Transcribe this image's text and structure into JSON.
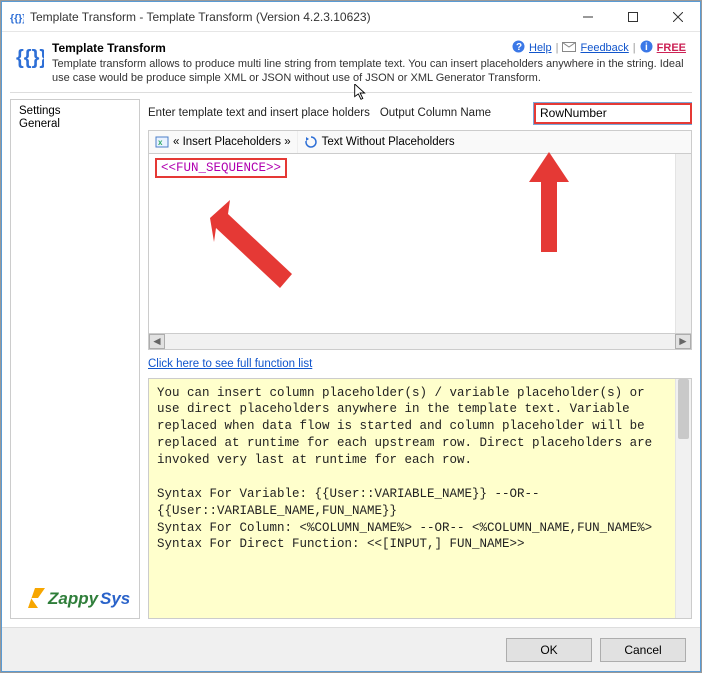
{
  "window": {
    "title": "Template Transform - Template Transform (Version 4.2.3.10623)"
  },
  "header": {
    "title": "Template Transform",
    "desc": "Template transform allows to produce multi line string from template text. You can insert placeholders anywhere in the string. Ideal use case would be produce simple XML or JSON without use of JSON or XML Generator Transform.",
    "help": "Help",
    "feedback": "Feedback",
    "free": "FREE"
  },
  "sidebar": {
    "items": [
      "Settings",
      "General"
    ]
  },
  "main": {
    "template_label": "Enter template text and insert place holders",
    "output_col_label": "Output Column Name",
    "output_col_value": "RowNumber",
    "toolbar": {
      "insert": "« Insert Placeholders »",
      "text_without": "Text Without Placeholders"
    },
    "editor_value": "<<FUN_SEQUENCE>>",
    "func_link": "Click here to see full function list",
    "helpbox": "You can insert column placeholder(s) / variable placeholder(s) or use direct placeholders anywhere in the template text. Variable replaced when data flow is started and column placeholder will be replaced at runtime for each upstream row. Direct placeholders are invoked very last at runtime for each row.\n\nSyntax For Variable: {{User::VARIABLE_NAME}} --OR-- {{User::VARIABLE_NAME,FUN_NAME}}\nSyntax For Column: <%COLUMN_NAME%> --OR-- <%COLUMN_NAME,FUN_NAME%>\nSyntax For Direct Function: <<[INPUT,] FUN_NAME>>"
  },
  "footer": {
    "ok": "OK",
    "cancel": "Cancel"
  },
  "brand": {
    "name1": "Zappy",
    "name2": "Sys"
  }
}
